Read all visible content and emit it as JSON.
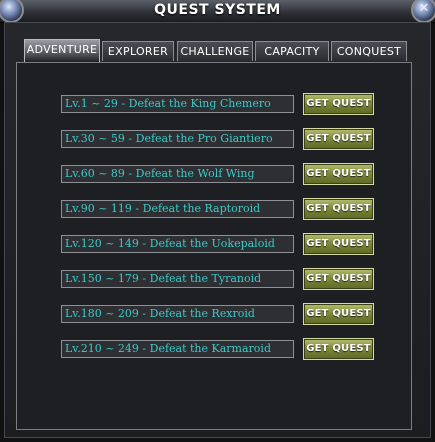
{
  "window": {
    "title": "QUEST SYSTEM",
    "close_glyph": "✕"
  },
  "tabs": [
    {
      "label": "ADVENTURE",
      "active": true
    },
    {
      "label": "EXPLORER",
      "active": false
    },
    {
      "label": "CHALLENGE",
      "active": false
    },
    {
      "label": "CAPACITY",
      "active": false
    },
    {
      "label": "CONQUEST",
      "active": false
    }
  ],
  "quest_button_label": "GET QUEST",
  "quests": [
    {
      "text": "Lv.1 ~ 29 - Defeat the King Chemero"
    },
    {
      "text": "Lv.30 ~ 59 - Defeat the Pro Giantiero"
    },
    {
      "text": "Lv.60 ~ 89 - Defeat the Wolf Wing"
    },
    {
      "text": "Lv.90 ~ 119 - Defeat the Raptoroid"
    },
    {
      "text": "Lv.120 ~ 149 - Defeat the Uokepaloid"
    },
    {
      "text": "Lv.150 ~ 179 - Defeat the Tyranoid"
    },
    {
      "text": "Lv.180 ~ 209 - Defeat the Rexroid"
    },
    {
      "text": "Lv.210 ~ 249 - Defeat the Karmaroid"
    }
  ],
  "colors": {
    "quest_text": "#3ec9c9",
    "button_olive": "#7f8a39"
  }
}
